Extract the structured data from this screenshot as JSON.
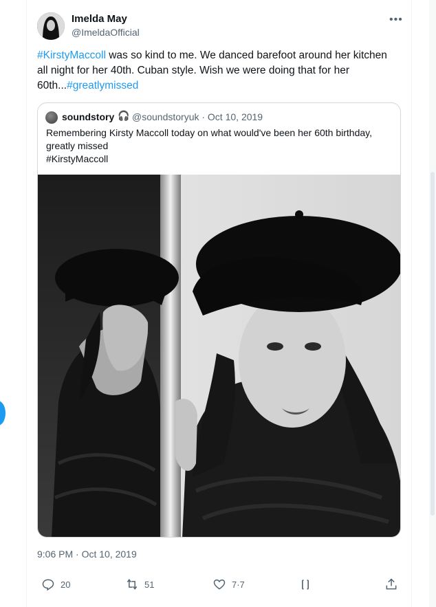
{
  "author": {
    "name": "Imelda May",
    "handle": "@ImeldaOfficial"
  },
  "tweet": {
    "hashtag1": "#KirstyMaccoll",
    "body": " was so kind to me. We danced barefoot around her kitchen all night for her 40th. Cuban style. Wish we were doing that for her 60th...",
    "hashtag2": "#greatlymissed"
  },
  "quote": {
    "name": "soundstory",
    "headphone": "🎧",
    "handle_date": "@soundstoryuk · Oct 10, 2019",
    "line1": "Remembering Kirsty Maccoll today on what would've been her 60th birthday,",
    "line2": "greatly missed",
    "line3": "#KirstyMaccoll"
  },
  "timestamp": "9:06 PM · Oct 10, 2019",
  "actions": {
    "replies": "20",
    "retweets": "51",
    "likes": "7·7"
  },
  "icons": [
    "more-icon",
    "reply-icon",
    "retweet-icon",
    "like-icon",
    "bookmark-icon",
    "share-icon"
  ],
  "colors": {
    "accent": "#1d9bf0",
    "muted": "#536471",
    "border": "#cfd9de"
  }
}
